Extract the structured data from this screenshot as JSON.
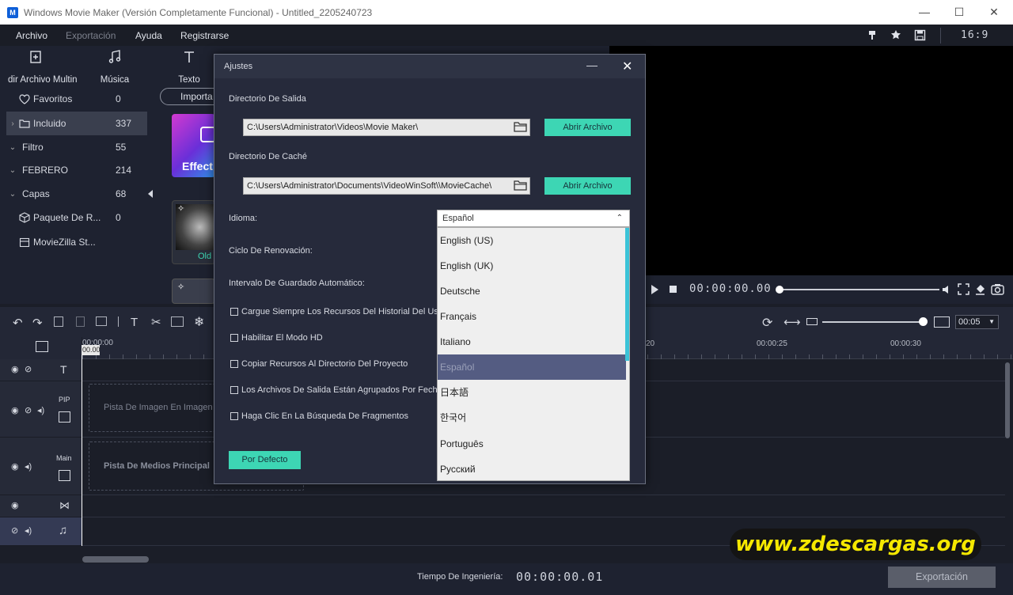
{
  "window": {
    "title": "Windows Movie Maker (Versión Completamente Funcional) - Untitled_2205240723",
    "logo_letter": "M"
  },
  "menu": {
    "items": [
      {
        "label": "Archivo",
        "enabled": true
      },
      {
        "label": "Exportación",
        "enabled": false
      },
      {
        "label": "Ayuda",
        "enabled": true
      },
      {
        "label": "Registrarse",
        "enabled": true
      }
    ],
    "ratio": "16:9"
  },
  "tool_categories": [
    {
      "label": "dir Archivo Multin",
      "icon": "import-media-icon"
    },
    {
      "label": "Música",
      "icon": "music-note-icon"
    },
    {
      "label": "Texto",
      "icon": "text-icon"
    }
  ],
  "library": {
    "items": [
      {
        "label": "Favoritos",
        "count": "0",
        "icon": "heart-icon",
        "chevron": ""
      },
      {
        "label": "Incluido",
        "count": "337",
        "icon": "folder-icon",
        "chevron": "›",
        "selected": true
      },
      {
        "label": "Filtro",
        "count": "55",
        "icon": "",
        "chevron": "⌄"
      },
      {
        "label": "FEBRERO",
        "count": "214",
        "icon": "",
        "chevron": "⌄"
      },
      {
        "label": "Capas",
        "count": "68",
        "icon": "",
        "chevron": "⌄"
      },
      {
        "label": "Paquete De R...",
        "count": "0",
        "icon": "package-icon",
        "chevron": ""
      },
      {
        "label": "MovieZilla St...",
        "count": "",
        "icon": "store-icon",
        "chevron": ""
      }
    ],
    "import_label": "Importa",
    "thumb_effect_label": "Effect",
    "thumb_old_label": "Old"
  },
  "player": {
    "time": "00:00:00.00"
  },
  "timeline": {
    "zoom_value": "00:05",
    "playhead_time": "00:00:00",
    "playhead_label": "00.00",
    "ruler_marks": [
      "20",
      "00:00:25",
      "00:00:30"
    ],
    "tracks": {
      "pip_label": "PIP",
      "pip_placeholder": "Pista De Imagen En Imagen",
      "main_label": "Main",
      "main_placeholder": "Pista De Medios Principal"
    }
  },
  "footer": {
    "engineering_time_label": "Tiempo De Ingeniería:",
    "engineering_time": "00:00:00.01",
    "export_label": "Exportación"
  },
  "watermark": "www.zdescargas.org",
  "dialog": {
    "title": "Ajustes",
    "output_dir_label": "Directorio De Salida",
    "output_dir_value": "C:\\Users\\Administrator\\Videos\\Movie Maker\\",
    "cache_dir_label": "Directorio De Caché",
    "cache_dir_value": "C:\\Users\\Administrator\\Documents\\VideoWinSoft\\\\MovieCache\\",
    "open_file_label": "Abrir Archivo",
    "language_label": "Idioma:",
    "language_selected": "Español",
    "renew_cycle_label": "Ciclo De Renovación:",
    "autosave_label": "Intervalo De Guardado Automático:",
    "checkboxes": [
      {
        "label": "Cargue Siempre Los Recursos Del Historial Del Usu",
        "checked": false
      },
      {
        "label": "Habilitar El Modo HD",
        "checked": false
      },
      {
        "label": "Copiar Recursos Al Directorio Del Proyecto",
        "checked": false
      },
      {
        "label": "Los Archivos De Salida Están Agrupados Por Fecha",
        "checked": false
      },
      {
        "label": "Haga Clic En La Búsqueda De Fragmentos",
        "checked": false
      }
    ],
    "default_label": "Por Defecto",
    "languages": [
      "English (US)",
      "English (UK)",
      "Deutsche",
      "Français",
      "Italiano",
      "Español",
      "日本語",
      "한국어",
      "Português",
      "Русский"
    ]
  }
}
